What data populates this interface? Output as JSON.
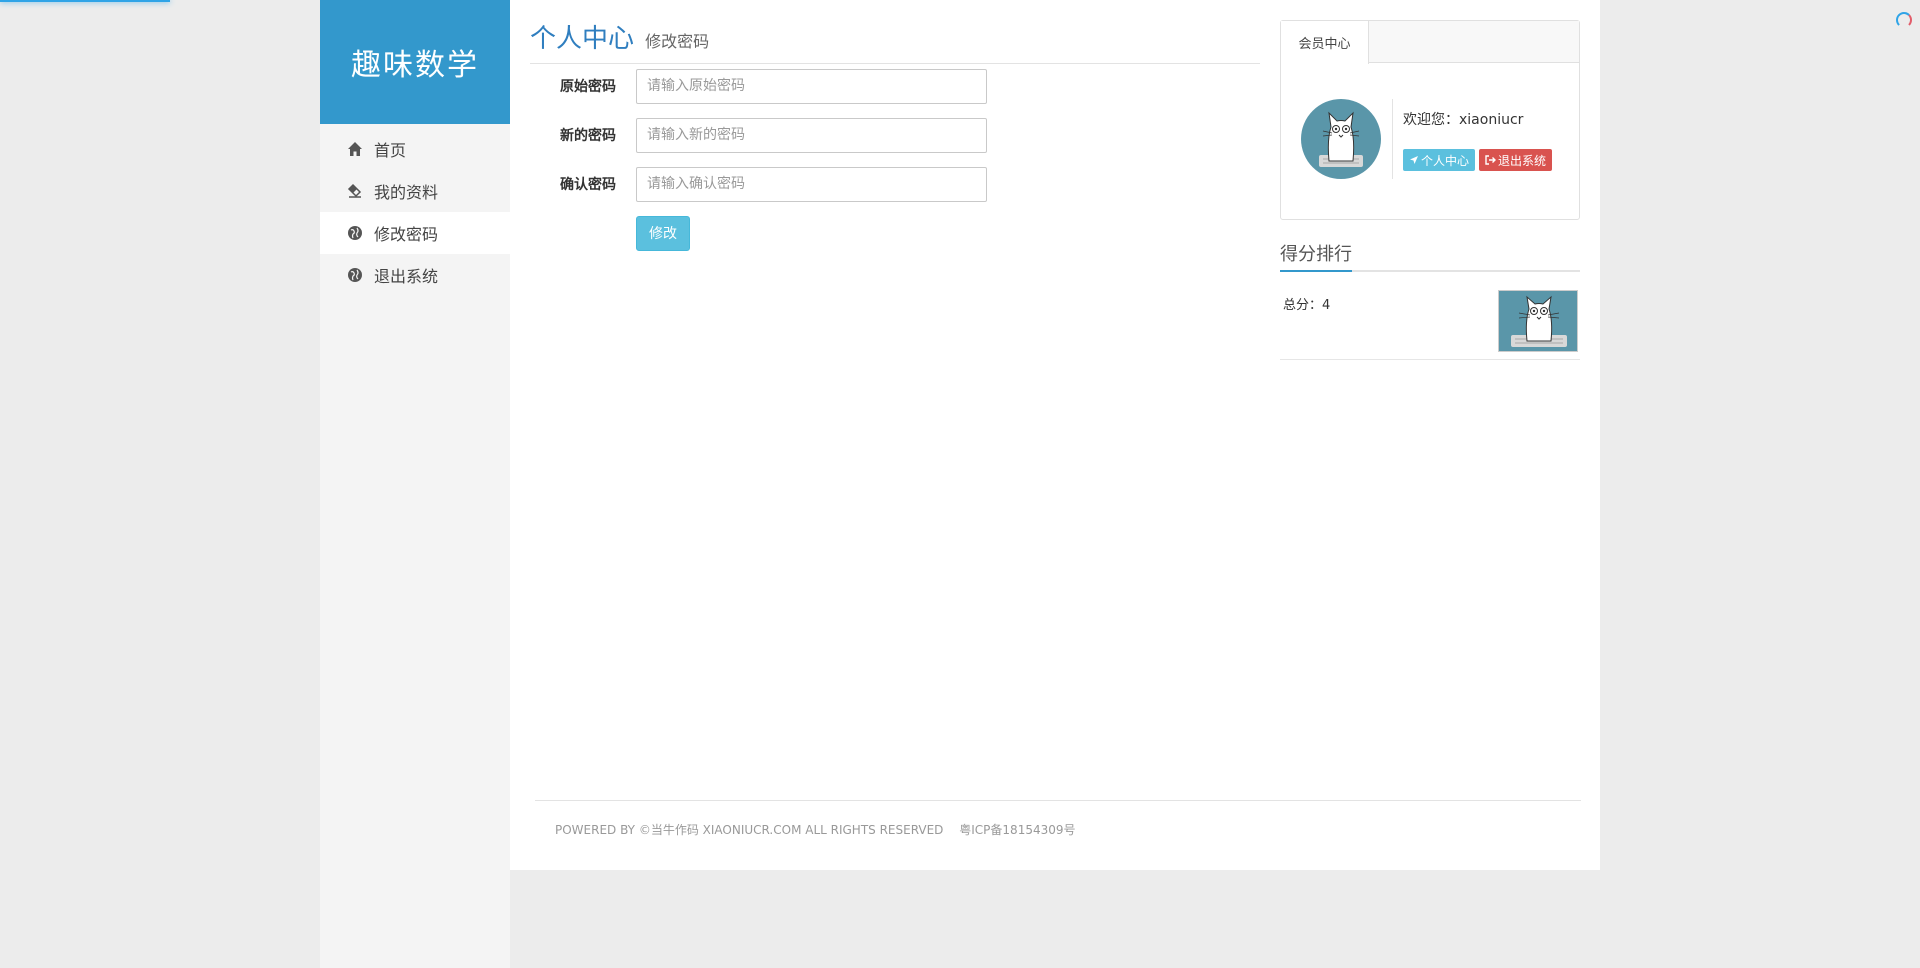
{
  "site": {
    "logo": "趣味数学"
  },
  "nav": {
    "items": [
      {
        "label": "首页",
        "icon": "home-icon"
      },
      {
        "label": "我的资料",
        "icon": "eraser-icon"
      },
      {
        "label": "修改密码",
        "icon": "globe-icon",
        "active": true
      },
      {
        "label": "退出系统",
        "icon": "globe-icon"
      }
    ]
  },
  "header": {
    "title": "个人中心",
    "subtitle": "修改密码"
  },
  "form": {
    "old_password": {
      "label": "原始密码",
      "placeholder": "请输入原始密码",
      "value": ""
    },
    "new_password": {
      "label": "新的密码",
      "placeholder": "请输入新的密码",
      "value": ""
    },
    "confirm_password": {
      "label": "确认密码",
      "placeholder": "请输入确认密码",
      "value": ""
    },
    "submit_label": "修改"
  },
  "member": {
    "tab": "会员中心",
    "welcome": "欢迎您：xiaoniucr",
    "profile_btn": "个人中心",
    "logout_btn": "退出系统"
  },
  "ranking": {
    "title": "得分排行",
    "items": [
      {
        "score_text": "总分：4"
      }
    ]
  },
  "footer": {
    "copyright": "POWERED BY ©当牛作码 XIAONIUCR.COM ALL RIGHTS RESERVED",
    "icp": "粤ICP备18154309号"
  },
  "colors": {
    "primary": "#3398cc",
    "info": "#5bc0de",
    "danger": "#d9534f"
  }
}
